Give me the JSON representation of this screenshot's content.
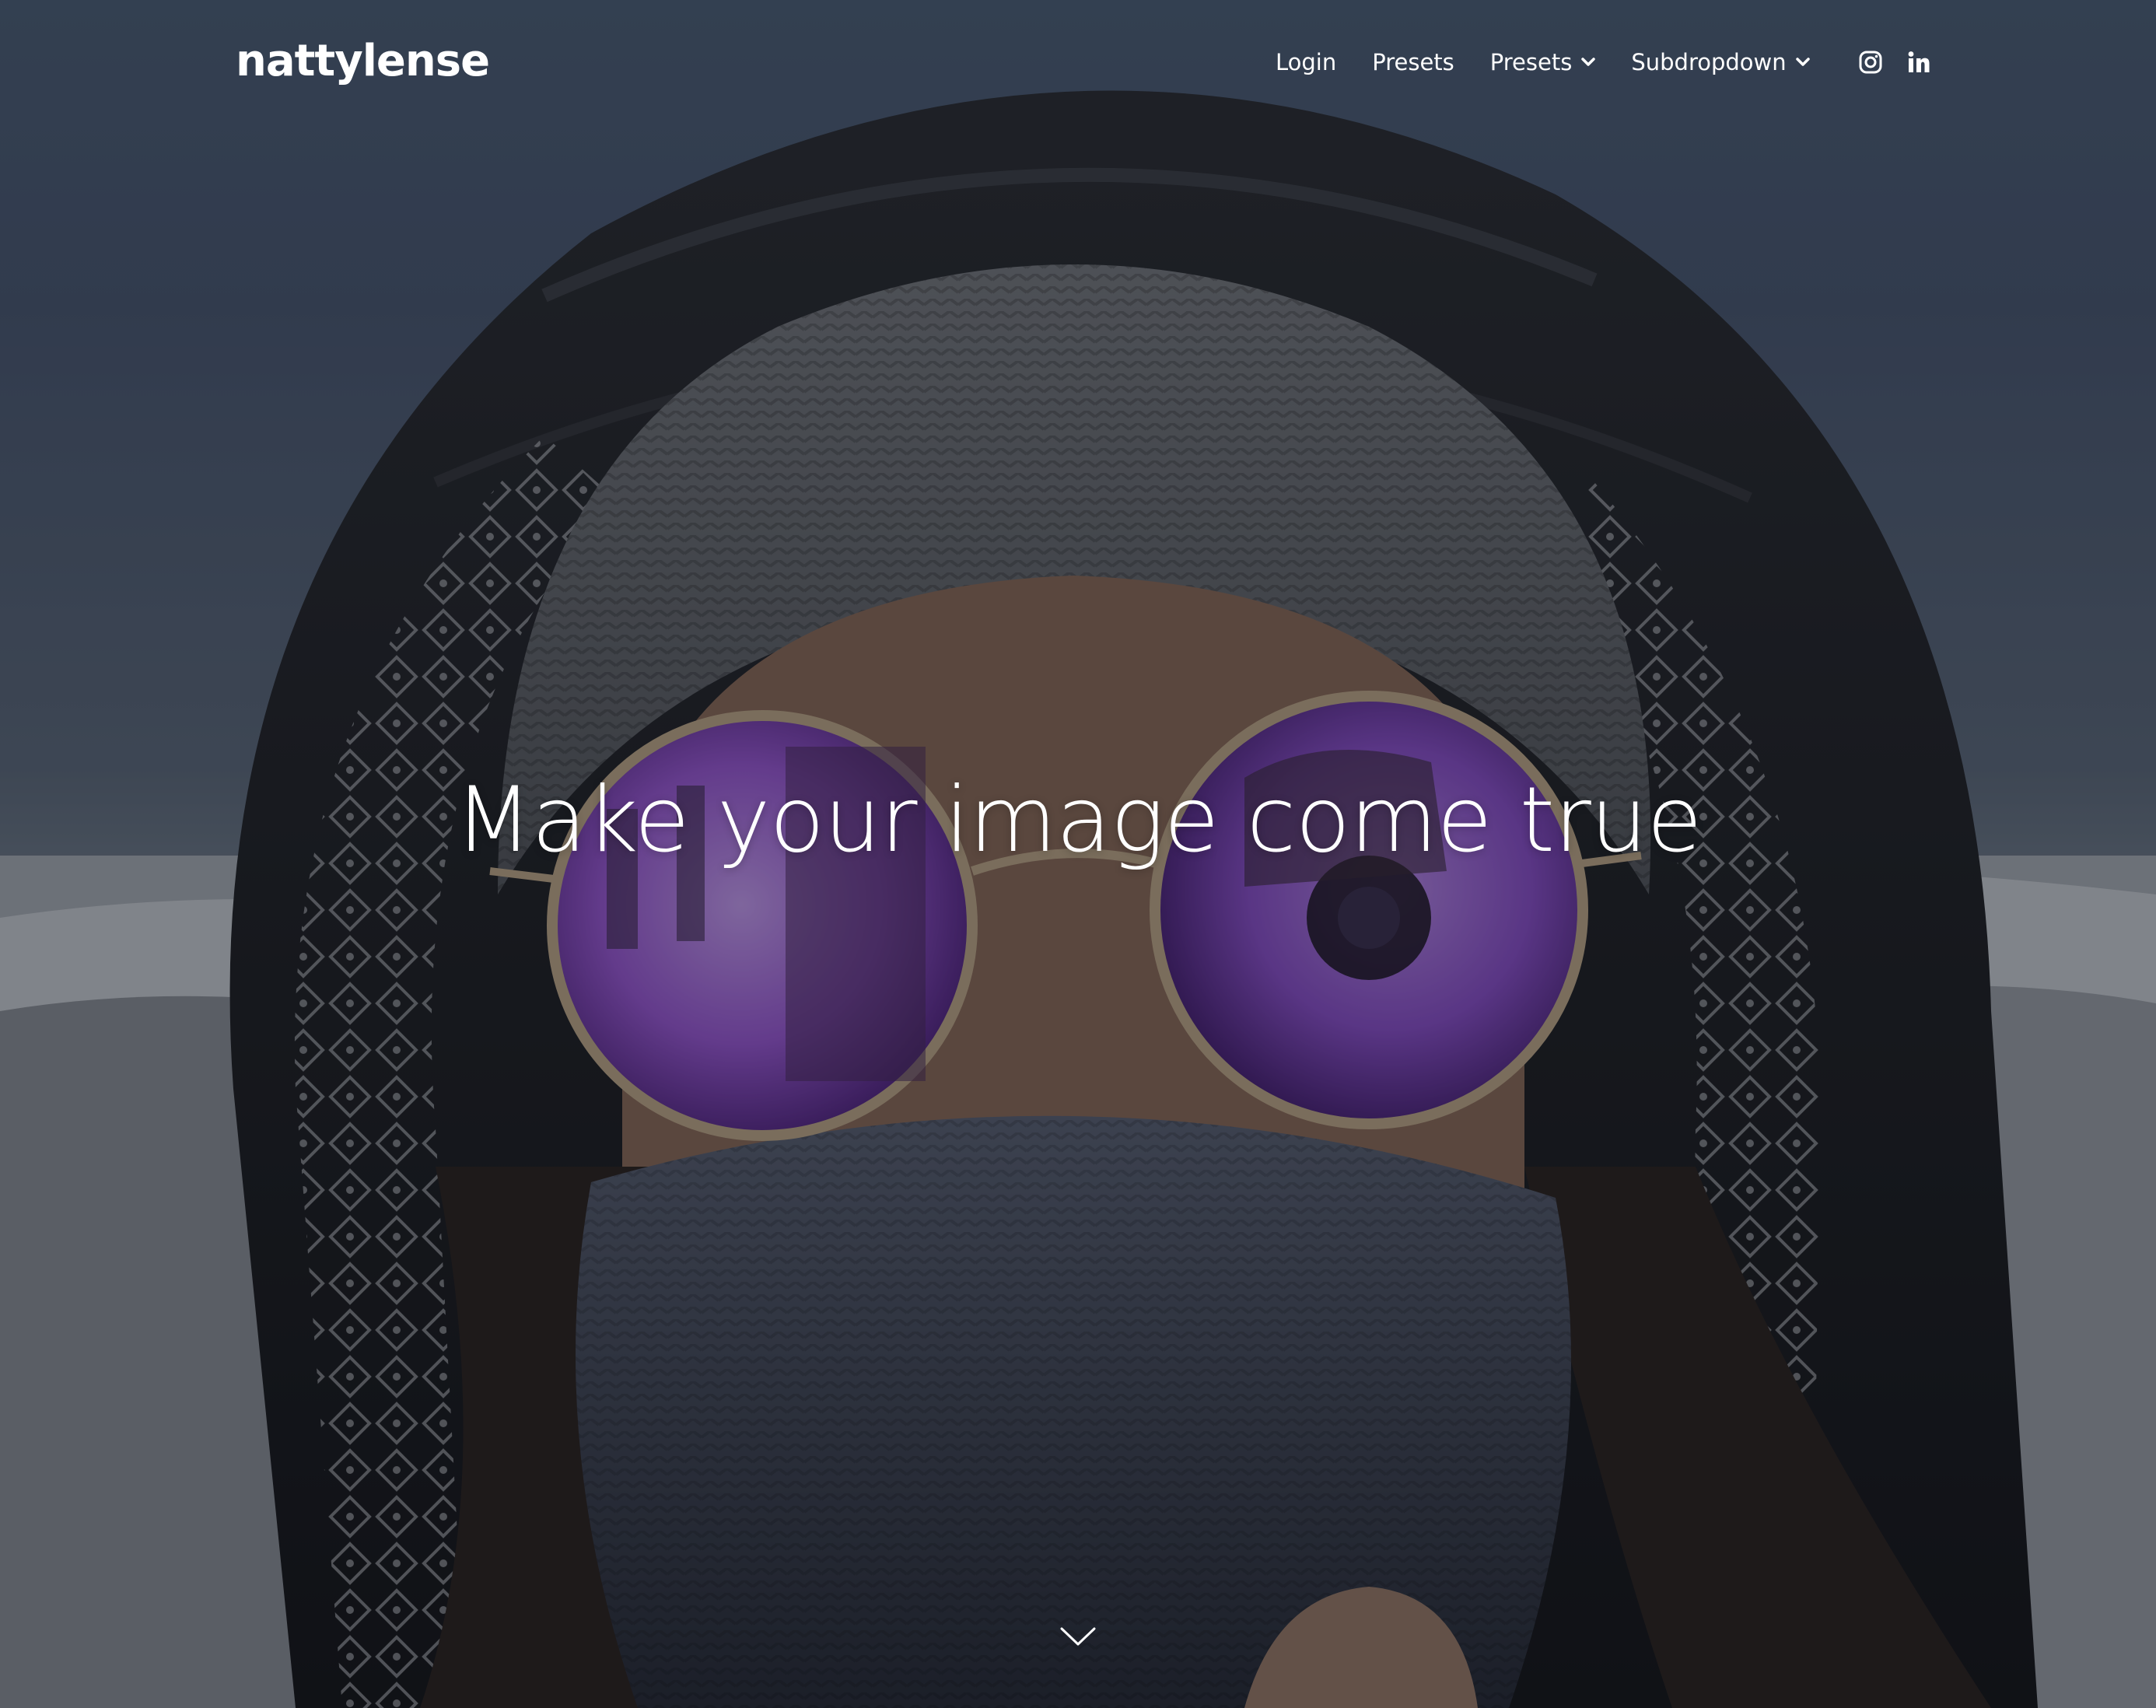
{
  "brand": {
    "logo_text": "nattylense"
  },
  "nav": {
    "items": [
      {
        "label": "Login",
        "has_dropdown": false
      },
      {
        "label": "Presets",
        "has_dropdown": false
      },
      {
        "label": "Presets",
        "has_dropdown": true
      },
      {
        "label": "Subdropdown",
        "has_dropdown": true
      }
    ],
    "social": [
      {
        "icon": "instagram-icon"
      },
      {
        "icon": "linkedin-icon"
      }
    ]
  },
  "hero": {
    "headline": "Make your image come true",
    "scroll_icon": "chevron-down-icon"
  },
  "colors": {
    "text": "#ffffff",
    "overlay": "#0a0c12",
    "lens": "#9b5fd6"
  }
}
